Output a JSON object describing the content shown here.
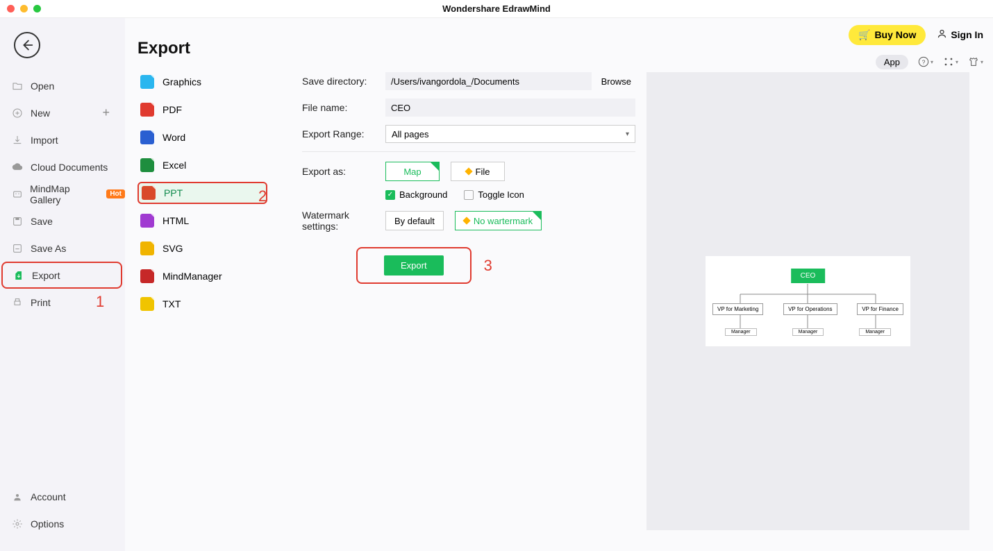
{
  "window": {
    "title": "Wondershare EdrawMind"
  },
  "header": {
    "buy_now": "Buy Now",
    "sign_in": "Sign In",
    "app_chip": "App"
  },
  "sidebar1": {
    "back_label": "Back",
    "items": [
      {
        "label": "Open"
      },
      {
        "label": "New",
        "plus": true
      },
      {
        "label": "Import"
      },
      {
        "label": "Cloud Documents"
      },
      {
        "label": "MindMap Gallery",
        "hot": "Hot"
      },
      {
        "label": "Save"
      },
      {
        "label": "Save As"
      },
      {
        "label": "Export",
        "highlighted": true
      },
      {
        "label": "Print"
      }
    ],
    "bottom": [
      {
        "label": "Account"
      },
      {
        "label": "Options"
      }
    ]
  },
  "sidebar2": {
    "title": "Export",
    "formats": [
      {
        "label": "Graphics",
        "bg": "#2ab6ef"
      },
      {
        "label": "PDF",
        "bg": "#e03a2f"
      },
      {
        "label": "Word",
        "bg": "#2a5fd1"
      },
      {
        "label": "Excel",
        "bg": "#1e8e3e"
      },
      {
        "label": "PPT",
        "bg": "#d94a2a",
        "selected": true
      },
      {
        "label": "HTML",
        "bg": "#a03ad1"
      },
      {
        "label": "SVG",
        "bg": "#f0b400"
      },
      {
        "label": "MindManager",
        "bg": "#c62828"
      },
      {
        "label": "TXT",
        "bg": "#f0c400"
      }
    ]
  },
  "form": {
    "save_dir_label": "Save directory:",
    "save_dir_value": "/Users/ivangordola_/Documents",
    "browse": "Browse",
    "file_name_label": "File name:",
    "file_name_value": "CEO",
    "range_label": "Export Range:",
    "range_value": "All pages",
    "export_as_label": "Export as:",
    "map": "Map",
    "file": "File",
    "background": "Background",
    "toggle_icon": "Toggle Icon",
    "watermark_label": "Watermark settings:",
    "wm_default": "By default",
    "wm_none": "No wartermark",
    "export_button": "Export"
  },
  "annotations": {
    "one": "1",
    "two": "2",
    "three": "3"
  },
  "preview": {
    "root": "CEO",
    "level2": [
      "VP for Marketing",
      "VP for Operations",
      "VP for Finance"
    ],
    "level3": [
      "Manager",
      "Manager",
      "Manager"
    ]
  }
}
